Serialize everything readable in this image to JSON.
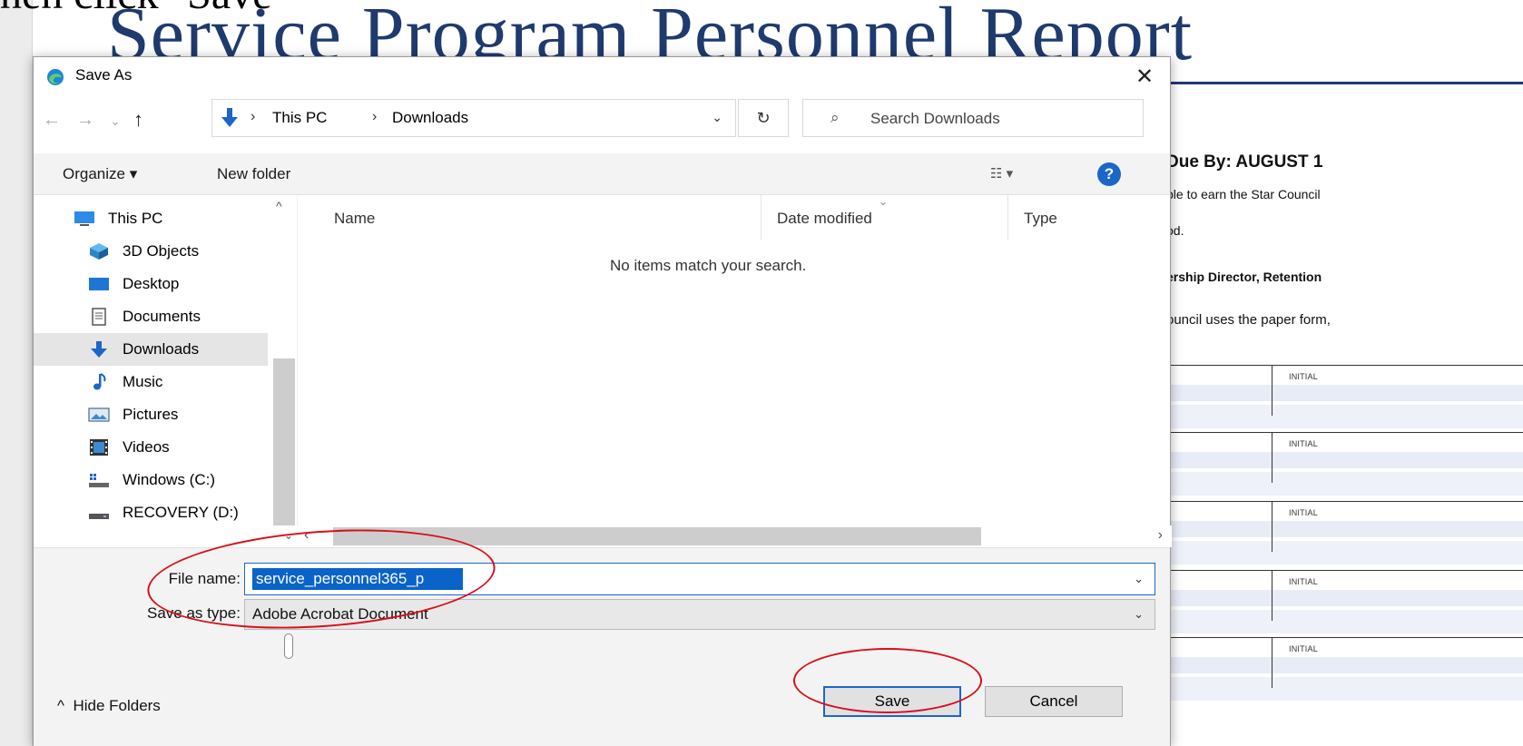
{
  "document": {
    "caption": "hen click \"Save\"",
    "title": "Service Program Personnel Report",
    "due_line": "Due By: AUGUST 1",
    "line1": "ble to earn the Star Council",
    "line2": "od.",
    "line3": "ership Director, Retention",
    "line4": "ouncil uses the paper form,",
    "rows": [
      {
        "initial_label": "INITIAL"
      },
      {
        "initial_label": "INITIAL"
      },
      {
        "initial_label": "INITIAL"
      },
      {
        "initial_label": "INITIAL"
      },
      {
        "initial_label": "INITIAL"
      }
    ]
  },
  "dialog": {
    "title": "Save As",
    "close_glyph": "✕",
    "nav": {
      "back_glyph": "←",
      "forward_glyph": "→",
      "recent_glyph": "⌄",
      "up_glyph": "↑",
      "breadcrumb": [
        "This PC",
        "Downloads"
      ],
      "separator": "›",
      "dropdown_glyph": "⌄",
      "refresh_glyph": "↻"
    },
    "search": {
      "placeholder": "Search Downloads",
      "icon": "search-icon"
    },
    "toolbar": {
      "organize_label": "Organize ▾",
      "new_folder_label": "New folder",
      "view_label": "☷ ▾",
      "help_label": "?"
    },
    "tree": [
      {
        "label": "This PC",
        "icon": "computer-icon"
      },
      {
        "label": "3D Objects",
        "icon": "cube-icon"
      },
      {
        "label": "Desktop",
        "icon": "desktop-icon"
      },
      {
        "label": "Documents",
        "icon": "document-icon"
      },
      {
        "label": "Downloads",
        "icon": "download-arrow-icon",
        "selected": true
      },
      {
        "label": "Music",
        "icon": "music-note-icon"
      },
      {
        "label": "Pictures",
        "icon": "picture-icon"
      },
      {
        "label": "Videos",
        "icon": "film-icon"
      },
      {
        "label": "Windows (C:)",
        "icon": "drive-icon"
      },
      {
        "label": "RECOVERY (D:)",
        "icon": "drive-icon"
      }
    ],
    "columns": {
      "name": "Name",
      "date_modified": "Date modified",
      "type": "Type"
    },
    "empty_message": "No items match your search.",
    "file_name": {
      "label": "File name:",
      "value": "service_personnel365_p"
    },
    "save_as_type": {
      "label": "Save as type:",
      "value": "Adobe Acrobat Document"
    },
    "hide_folders_label": "Hide Folders",
    "hide_folders_glyph": "^",
    "save_label": "Save",
    "cancel_label": "Cancel"
  },
  "colors": {
    "accent": "#1b66c9",
    "annotation": "#d90f1a",
    "title_blue": "#1f3a6e"
  }
}
